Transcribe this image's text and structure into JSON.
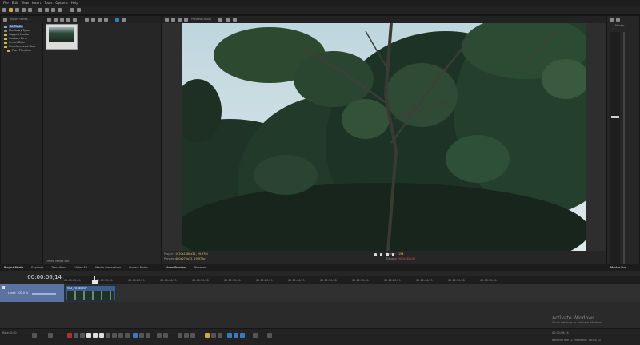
{
  "menu": [
    "File",
    "Edit",
    "View",
    "Insert",
    "Tools",
    "Options",
    "Help"
  ],
  "project_media": {
    "header_label": "Import Media...",
    "tree": [
      "All Media",
      "Media by Type",
      "Tagged Media",
      "Custom Bins",
      "Smart Bins",
      "Unreferenced Bins",
      "Plan Timeline"
    ],
    "thumb_label": "",
    "offline_label": "Offline Media Bar"
  },
  "left_tabs": [
    "Project Media",
    "Explorer",
    "Transitions",
    "Video FX",
    "Media Generators",
    "Project Notes"
  ],
  "preview": {
    "toolbar_label": "Preview (Auto)",
    "info": {
      "project_label": "Project:",
      "project_value": "1920x1080x32, 29.970i",
      "preview_label": "Preview:",
      "preview_value": "480x270x32, 29.970p",
      "frame_label": "Frame:",
      "frame_value": "194",
      "display_label": "Display:",
      "display_value": "500x282x32"
    }
  },
  "preview_tabs": [
    "Video Preview",
    "Trimmer"
  ],
  "master": {
    "label": "Master",
    "tab": "Master Bus"
  },
  "timeline": {
    "timecode": "00:00:06;14",
    "ruler_marks": [
      "00:00:00;00",
      "00:00:15;00",
      "00:00:29;29",
      "00:00:44;29",
      "00:00:59;28",
      "00:01:15;00",
      "00:01:29;29",
      "00:01:44;29",
      "00:01:59;28",
      "00:02:15;00",
      "00:02:29;29",
      "00:02:44;29",
      "00:02:59;28",
      "00:03:15;00"
    ],
    "track_level": "Level: 100.0 %",
    "clip_label": "VID_20180607",
    "rate_label": "Rate: 0.00"
  },
  "transport": {
    "timecode_right": "00:00:06;14",
    "status": "Record Time (2 channels): 38:05:10"
  },
  "watermark": {
    "title": "Activate Windows",
    "subtitle": "Go to Settings to activate Windows."
  },
  "colors": {
    "sky": "#c9dce2",
    "foliage_dark": "#1b2a22",
    "clip_blue": "#4a6aa0",
    "accent_yellow": "#e0c040"
  }
}
